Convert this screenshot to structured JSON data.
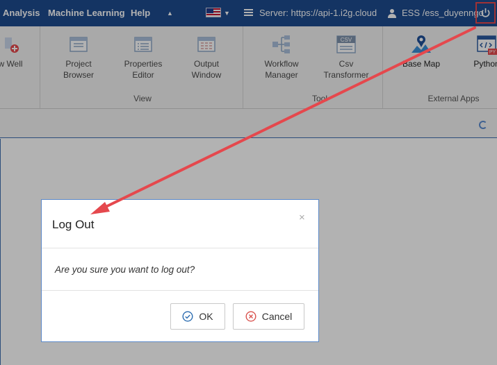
{
  "topbar": {
    "menu": [
      "Analysis",
      "Machine Learning",
      "Help"
    ],
    "server_label": "Server: https://api-1.i2g.cloud",
    "user_label": "ESS /ess_duyenngo"
  },
  "ribbon": {
    "buttons": [
      {
        "label": "w Well",
        "icon": "new-well-icon"
      },
      {
        "label": "Project Browser",
        "icon": "project-browser-icon"
      },
      {
        "label": "Properties Editor",
        "icon": "properties-editor-icon"
      },
      {
        "label": "Output Window",
        "icon": "output-window-icon"
      },
      {
        "label": "Workflow Manager",
        "icon": "workflow-manager-icon"
      },
      {
        "label": "Csv Transformer",
        "icon": "csv-transformer-icon"
      },
      {
        "label": "Base Map",
        "icon": "base-map-icon"
      },
      {
        "label": "Python",
        "icon": "python-icon"
      }
    ],
    "groups": [
      "View",
      "Tool",
      "External Apps"
    ],
    "csv_badge": "CSV",
    "py_badge": "PY"
  },
  "dialog": {
    "title": "Log Out",
    "close": "×",
    "message": "Are you sure you want to log out?",
    "ok": "OK",
    "cancel": "Cancel"
  },
  "colors": {
    "topbar": "#1e4b8f",
    "accent": "#3f6fb0",
    "highlight": "#e5484d",
    "ok_icon": "#2b6cb0",
    "cancel_icon": "#d9534f"
  }
}
